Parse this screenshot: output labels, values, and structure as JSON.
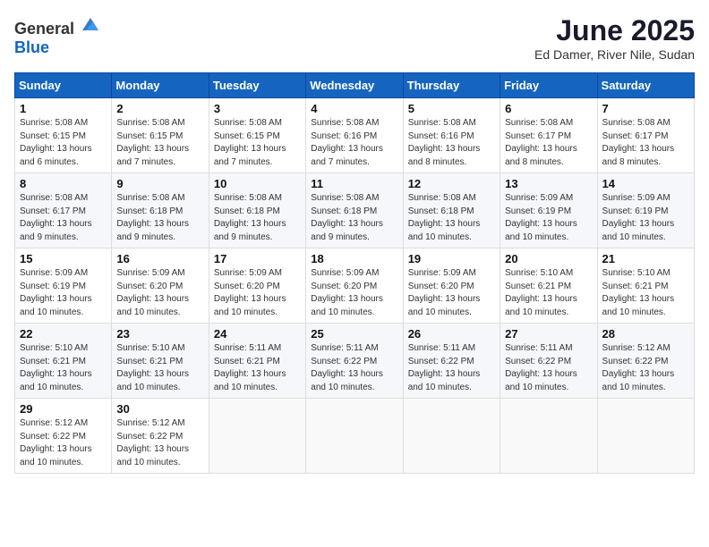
{
  "header": {
    "logo_general": "General",
    "logo_blue": "Blue",
    "month": "June 2025",
    "location": "Ed Damer, River Nile, Sudan"
  },
  "days_of_week": [
    "Sunday",
    "Monday",
    "Tuesday",
    "Wednesday",
    "Thursday",
    "Friday",
    "Saturday"
  ],
  "weeks": [
    [
      {
        "day": 1,
        "sunrise": "5:08 AM",
        "sunset": "6:15 PM",
        "daylight": "13 hours and 6 minutes."
      },
      {
        "day": 2,
        "sunrise": "5:08 AM",
        "sunset": "6:15 PM",
        "daylight": "13 hours and 7 minutes."
      },
      {
        "day": 3,
        "sunrise": "5:08 AM",
        "sunset": "6:15 PM",
        "daylight": "13 hours and 7 minutes."
      },
      {
        "day": 4,
        "sunrise": "5:08 AM",
        "sunset": "6:16 PM",
        "daylight": "13 hours and 7 minutes."
      },
      {
        "day": 5,
        "sunrise": "5:08 AM",
        "sunset": "6:16 PM",
        "daylight": "13 hours and 8 minutes."
      },
      {
        "day": 6,
        "sunrise": "5:08 AM",
        "sunset": "6:17 PM",
        "daylight": "13 hours and 8 minutes."
      },
      {
        "day": 7,
        "sunrise": "5:08 AM",
        "sunset": "6:17 PM",
        "daylight": "13 hours and 8 minutes."
      }
    ],
    [
      {
        "day": 8,
        "sunrise": "5:08 AM",
        "sunset": "6:17 PM",
        "daylight": "13 hours and 9 minutes."
      },
      {
        "day": 9,
        "sunrise": "5:08 AM",
        "sunset": "6:18 PM",
        "daylight": "13 hours and 9 minutes."
      },
      {
        "day": 10,
        "sunrise": "5:08 AM",
        "sunset": "6:18 PM",
        "daylight": "13 hours and 9 minutes."
      },
      {
        "day": 11,
        "sunrise": "5:08 AM",
        "sunset": "6:18 PM",
        "daylight": "13 hours and 9 minutes."
      },
      {
        "day": 12,
        "sunrise": "5:08 AM",
        "sunset": "6:18 PM",
        "daylight": "13 hours and 10 minutes."
      },
      {
        "day": 13,
        "sunrise": "5:09 AM",
        "sunset": "6:19 PM",
        "daylight": "13 hours and 10 minutes."
      },
      {
        "day": 14,
        "sunrise": "5:09 AM",
        "sunset": "6:19 PM",
        "daylight": "13 hours and 10 minutes."
      }
    ],
    [
      {
        "day": 15,
        "sunrise": "5:09 AM",
        "sunset": "6:19 PM",
        "daylight": "13 hours and 10 minutes."
      },
      {
        "day": 16,
        "sunrise": "5:09 AM",
        "sunset": "6:20 PM",
        "daylight": "13 hours and 10 minutes."
      },
      {
        "day": 17,
        "sunrise": "5:09 AM",
        "sunset": "6:20 PM",
        "daylight": "13 hours and 10 minutes."
      },
      {
        "day": 18,
        "sunrise": "5:09 AM",
        "sunset": "6:20 PM",
        "daylight": "13 hours and 10 minutes."
      },
      {
        "day": 19,
        "sunrise": "5:09 AM",
        "sunset": "6:20 PM",
        "daylight": "13 hours and 10 minutes."
      },
      {
        "day": 20,
        "sunrise": "5:10 AM",
        "sunset": "6:21 PM",
        "daylight": "13 hours and 10 minutes."
      },
      {
        "day": 21,
        "sunrise": "5:10 AM",
        "sunset": "6:21 PM",
        "daylight": "13 hours and 10 minutes."
      }
    ],
    [
      {
        "day": 22,
        "sunrise": "5:10 AM",
        "sunset": "6:21 PM",
        "daylight": "13 hours and 10 minutes."
      },
      {
        "day": 23,
        "sunrise": "5:10 AM",
        "sunset": "6:21 PM",
        "daylight": "13 hours and 10 minutes."
      },
      {
        "day": 24,
        "sunrise": "5:11 AM",
        "sunset": "6:21 PM",
        "daylight": "13 hours and 10 minutes."
      },
      {
        "day": 25,
        "sunrise": "5:11 AM",
        "sunset": "6:22 PM",
        "daylight": "13 hours and 10 minutes."
      },
      {
        "day": 26,
        "sunrise": "5:11 AM",
        "sunset": "6:22 PM",
        "daylight": "13 hours and 10 minutes."
      },
      {
        "day": 27,
        "sunrise": "5:11 AM",
        "sunset": "6:22 PM",
        "daylight": "13 hours and 10 minutes."
      },
      {
        "day": 28,
        "sunrise": "5:12 AM",
        "sunset": "6:22 PM",
        "daylight": "13 hours and 10 minutes."
      }
    ],
    [
      {
        "day": 29,
        "sunrise": "5:12 AM",
        "sunset": "6:22 PM",
        "daylight": "13 hours and 10 minutes."
      },
      {
        "day": 30,
        "sunrise": "5:12 AM",
        "sunset": "6:22 PM",
        "daylight": "13 hours and 10 minutes."
      },
      null,
      null,
      null,
      null,
      null
    ]
  ],
  "labels": {
    "sunrise": "Sunrise:",
    "sunset": "Sunset:",
    "daylight": "Daylight:"
  }
}
